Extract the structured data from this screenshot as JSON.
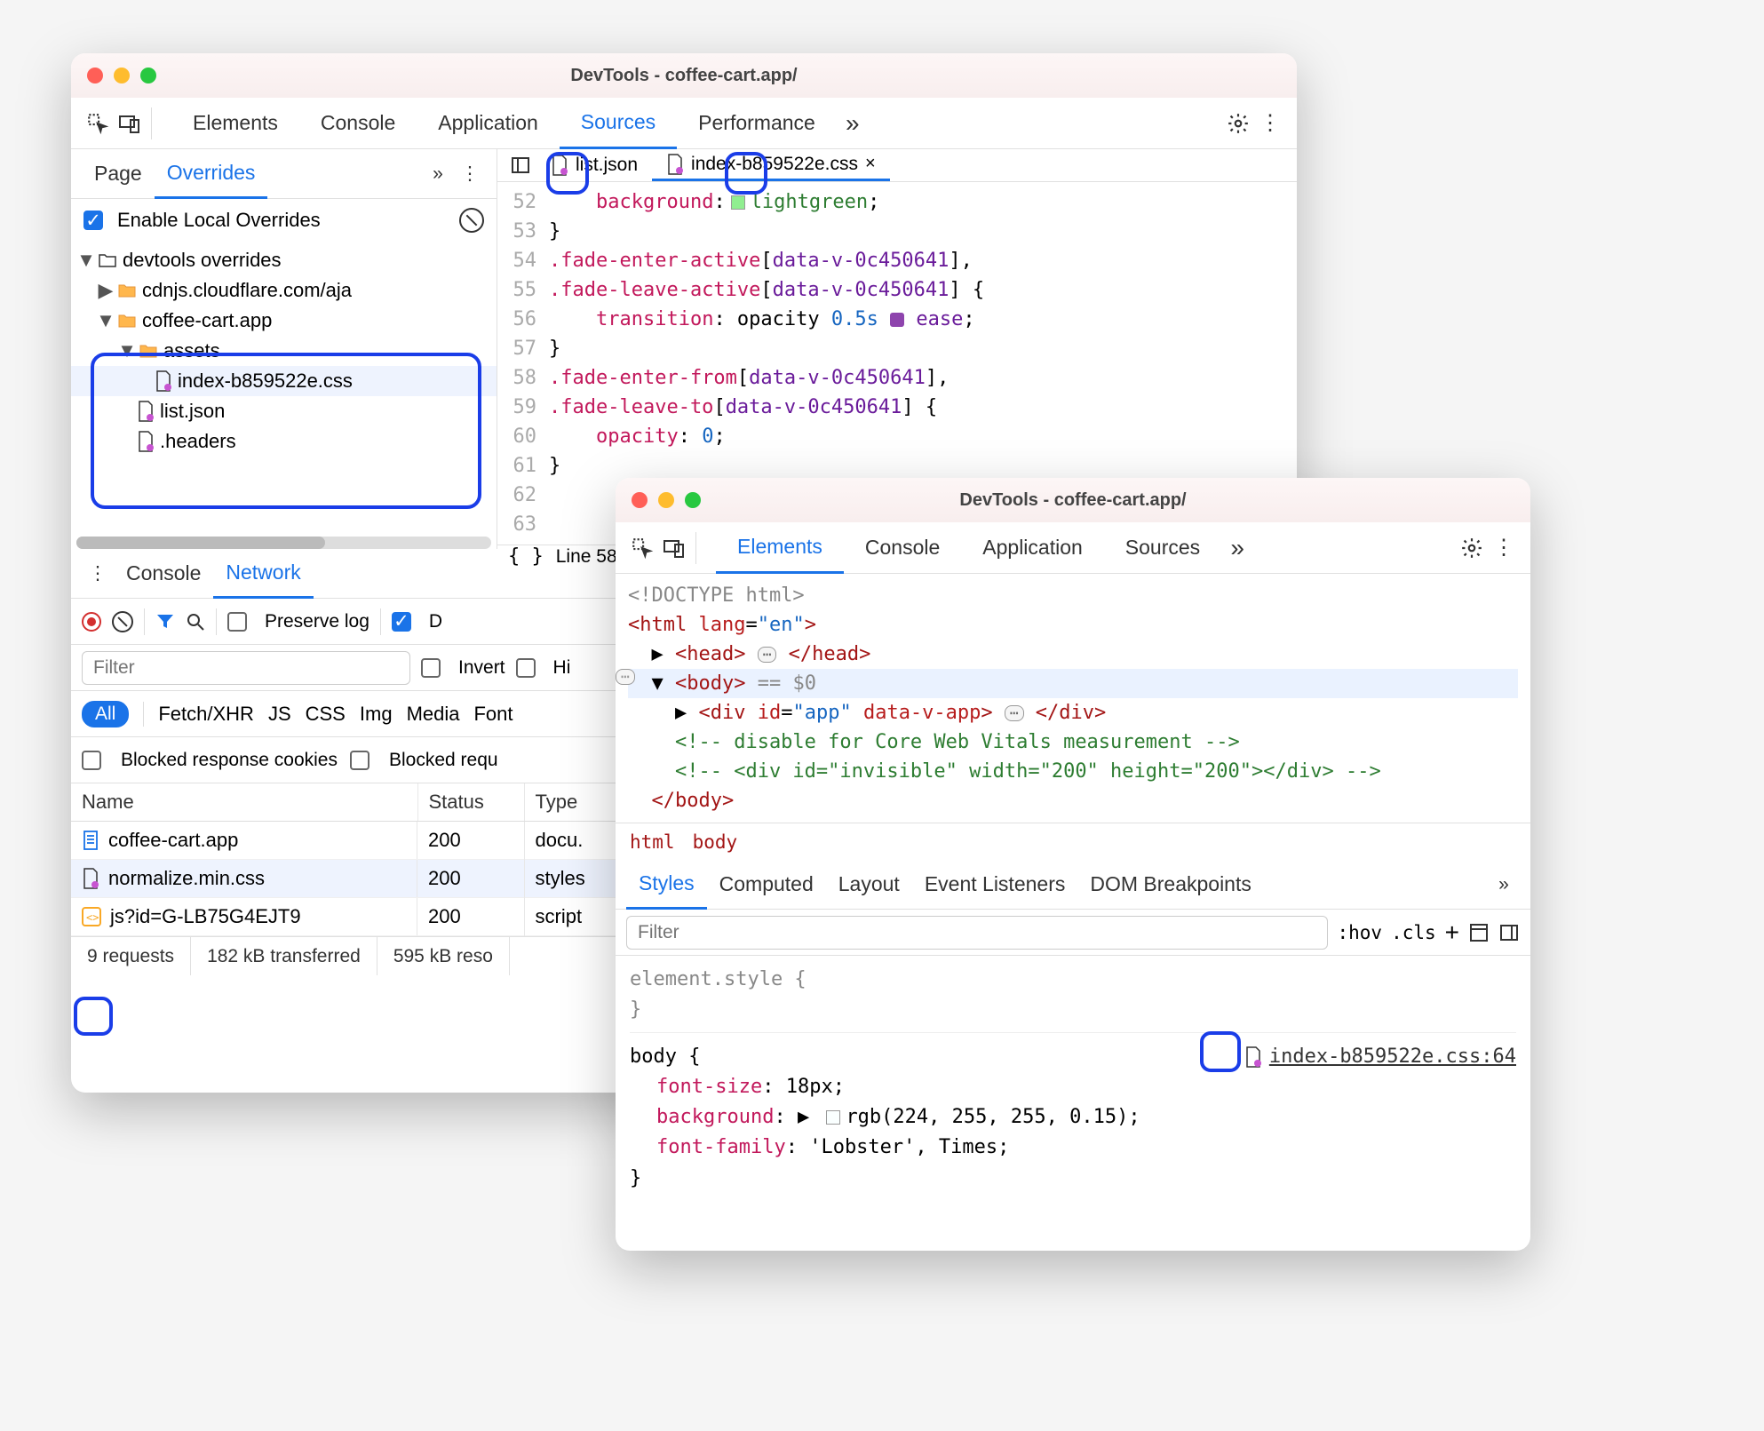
{
  "window1": {
    "title": "DevTools - coffee-cart.app/",
    "main_tabs": [
      "Elements",
      "Console",
      "Application",
      "Sources",
      "Performance"
    ],
    "main_tab_active": "Sources",
    "sidebar_tabs": [
      "Page",
      "Overrides"
    ],
    "sidebar_tab_active": "Overrides",
    "enable_overrides_label": "Enable Local Overrides",
    "tree": {
      "root": "devtools overrides",
      "n1": "cdnjs.cloudflare.com/aja",
      "n2": "coffee-cart.app",
      "n3": "assets",
      "n4": "index-b859522e.css",
      "n5": "list.json",
      "n6": ".headers"
    },
    "open_files": {
      "f1": "list.json",
      "f2": "index-b859522e.css"
    },
    "code": {
      "52": {
        "indent": "    ",
        "p": "background",
        "v": "lightgreen",
        "swatch": "#90ee90",
        "end": ";"
      },
      "53": "}",
      "54": {
        "cls": ".fade-enter-active",
        "attr": "[data-v-0c450641]",
        "end": ","
      },
      "55": {
        "cls": ".fade-leave-active",
        "attr": "[data-v-0c450641]",
        "end": " {"
      },
      "56": {
        "indent": "    ",
        "p": "transition",
        "raw": "opacity ",
        "num": "0.5s ",
        "ease": "ease",
        "end": ";"
      },
      "57": "}",
      "58": {
        "cls": ".fade-enter-from",
        "attr": "[data-v-0c450641]",
        "end": ","
      },
      "59": {
        "cls": ".fade-leave-to",
        "attr": "[data-v-0c450641]",
        "end": " {"
      },
      "60": {
        "indent": "    ",
        "p": "opacity",
        "num": "0",
        "end": ";"
      },
      "61": "}",
      "62": "",
      "63": ""
    },
    "code_footer": "Line 58",
    "drawer_tabs": [
      "Console",
      "Network"
    ],
    "drawer_tab_active": "Network",
    "preserve_log_label": "Preserve log",
    "disable_cache_label": "D",
    "filter_placeholder": "Filter",
    "invert_label": "Invert",
    "hide_label": "Hi",
    "type_filters": [
      "All",
      "Fetch/XHR",
      "JS",
      "CSS",
      "Img",
      "Media",
      "Font"
    ],
    "blocked_cookies_label": "Blocked response cookies",
    "blocked_requests_label": "Blocked requ",
    "table": {
      "cols": [
        "Name",
        "Status",
        "Type"
      ],
      "rows": [
        {
          "name": "coffee-cart.app",
          "status": "200",
          "type": "docu.",
          "icon": "doc"
        },
        {
          "name": "normalize.min.css",
          "status": "200",
          "type": "styles",
          "icon": "override"
        },
        {
          "name": "js?id=G-LB75G4EJT9",
          "status": "200",
          "type": "script",
          "icon": "js"
        }
      ]
    },
    "status": {
      "requests": "9 requests",
      "transferred": "182 kB transferred",
      "resources": "595 kB reso"
    }
  },
  "window2": {
    "title": "DevTools - coffee-cart.app/",
    "main_tabs": [
      "Elements",
      "Console",
      "Application",
      "Sources"
    ],
    "main_tab_active": "Elements",
    "dom": {
      "doctype": "<!DOCTYPE html>",
      "html_open": "<html lang=\"en\">",
      "head": {
        "open": "<head>",
        "close": "</head>"
      },
      "body_open": "<body>",
      "body_suffix": " == $0",
      "div_app": "<div id=\"app\" data-v-app>",
      "div_close": "</div>",
      "comment1": "<!-- disable for Core Web Vitals measurement -->",
      "comment2": "<!-- <div id=\"invisible\" width=\"200\" height=\"200\"></div> -->",
      "body_close": "</body>"
    },
    "crumb": [
      "html",
      "body"
    ],
    "styles_tabs": [
      "Styles",
      "Computed",
      "Layout",
      "Event Listeners",
      "DOM Breakpoints"
    ],
    "styles_tab_active": "Styles",
    "filter_placeholder": "Filter",
    "hov": ":hov",
    "cls": ".cls",
    "element_style": "element.style {",
    "element_style_close": "}",
    "body_rule": {
      "sel": "body {",
      "link": "index-b859522e.css:64",
      "font_size": {
        "p": "font-size",
        "v": "18px"
      },
      "background": {
        "p": "background",
        "v": "rgb(224, 255, 255, 0.15)",
        "swatch": "rgba(224,255,255,0.15)"
      },
      "font_family": {
        "p": "font-family",
        "v": "'Lobster', Times"
      },
      "close": "}"
    }
  }
}
